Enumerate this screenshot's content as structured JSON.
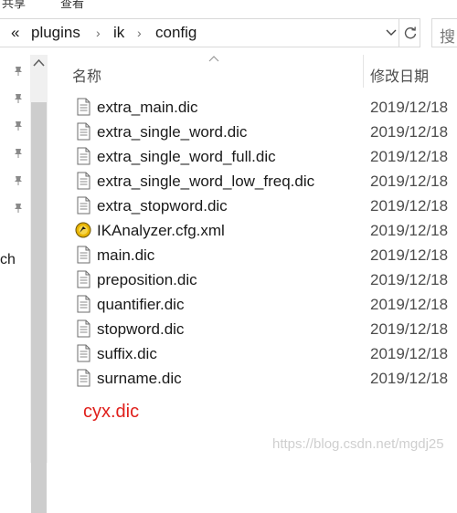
{
  "ribbon": {
    "left_label": "共享",
    "right_label": "查看"
  },
  "address_bar": {
    "overflow_glyph": "«",
    "segments": [
      "plugins",
      "ik",
      "config"
    ]
  },
  "search": {
    "placeholder": "搜"
  },
  "nav_pane": {
    "cut_label": "ch"
  },
  "columns": {
    "name": "名称",
    "modified": "修改日期"
  },
  "files": [
    {
      "name": "extra_main.dic",
      "date": "2019/12/18",
      "icon": "text-file-icon"
    },
    {
      "name": "extra_single_word.dic",
      "date": "2019/12/18",
      "icon": "text-file-icon"
    },
    {
      "name": "extra_single_word_full.dic",
      "date": "2019/12/18",
      "icon": "text-file-icon"
    },
    {
      "name": "extra_single_word_low_freq.dic",
      "date": "2019/12/18",
      "icon": "text-file-icon"
    },
    {
      "name": "extra_stopword.dic",
      "date": "2019/12/18",
      "icon": "text-file-icon"
    },
    {
      "name": "IKAnalyzer.cfg.xml",
      "date": "2019/12/18",
      "icon": "xml-file-icon"
    },
    {
      "name": "main.dic",
      "date": "2019/12/18",
      "icon": "text-file-icon"
    },
    {
      "name": "preposition.dic",
      "date": "2019/12/18",
      "icon": "text-file-icon"
    },
    {
      "name": "quantifier.dic",
      "date": "2019/12/18",
      "icon": "text-file-icon"
    },
    {
      "name": "stopword.dic",
      "date": "2019/12/18",
      "icon": "text-file-icon"
    },
    {
      "name": "suffix.dic",
      "date": "2019/12/18",
      "icon": "text-file-icon"
    },
    {
      "name": "surname.dic",
      "date": "2019/12/18",
      "icon": "text-file-icon"
    }
  ],
  "annotation": {
    "text": "cyx.dic",
    "color": "#e0201c"
  },
  "watermark": "https://blog.csdn.net/mgdj25"
}
